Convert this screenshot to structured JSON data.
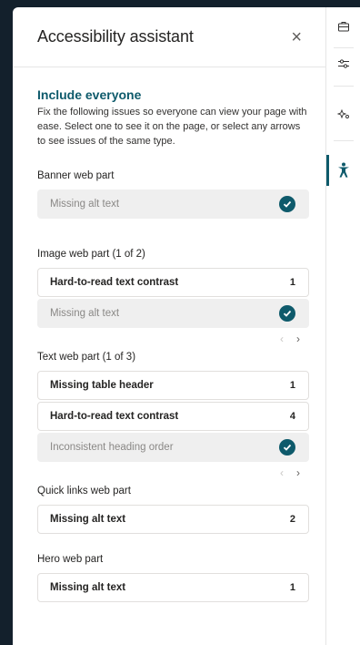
{
  "panel": {
    "title": "Accessibility assistant",
    "close_glyph": "×"
  },
  "intro": {
    "heading": "Include everyone",
    "text": "Fix the following issues so everyone can view your page with ease. Select one to see it on the page, or select any arrows to see issues of the same type."
  },
  "sections": {
    "banner": {
      "label": "Banner web part",
      "items": [
        {
          "label": "Missing alt text",
          "status": "resolved"
        }
      ]
    },
    "image": {
      "label": "Image web part (1 of 2)",
      "items": [
        {
          "label": "Hard-to-read text contrast",
          "count": "1"
        },
        {
          "label": "Missing alt text",
          "status": "resolved"
        }
      ]
    },
    "text": {
      "label": "Text web part (1 of 3)",
      "items": [
        {
          "label": "Missing table header",
          "count": "1"
        },
        {
          "label": "Hard-to-read text contrast",
          "count": "4"
        },
        {
          "label": "Inconsistent heading order",
          "status": "resolved"
        }
      ]
    },
    "quicklinks": {
      "label": "Quick links web part",
      "items": [
        {
          "label": "Missing alt text",
          "count": "2"
        }
      ]
    },
    "hero": {
      "label": "Hero web part",
      "items": [
        {
          "label": "Missing alt text",
          "count": "1"
        }
      ]
    }
  },
  "pager": {
    "prev_glyph": "‹",
    "next_glyph": "›"
  },
  "rail": {
    "icons": [
      "briefcase-icon",
      "sliders-icon",
      "sparkle-icon",
      "accessibility-icon"
    ],
    "active": "accessibility-icon"
  },
  "colors": {
    "accent": "#0e5a6b",
    "background": "#13202c",
    "resolved_row": "#efefef"
  }
}
